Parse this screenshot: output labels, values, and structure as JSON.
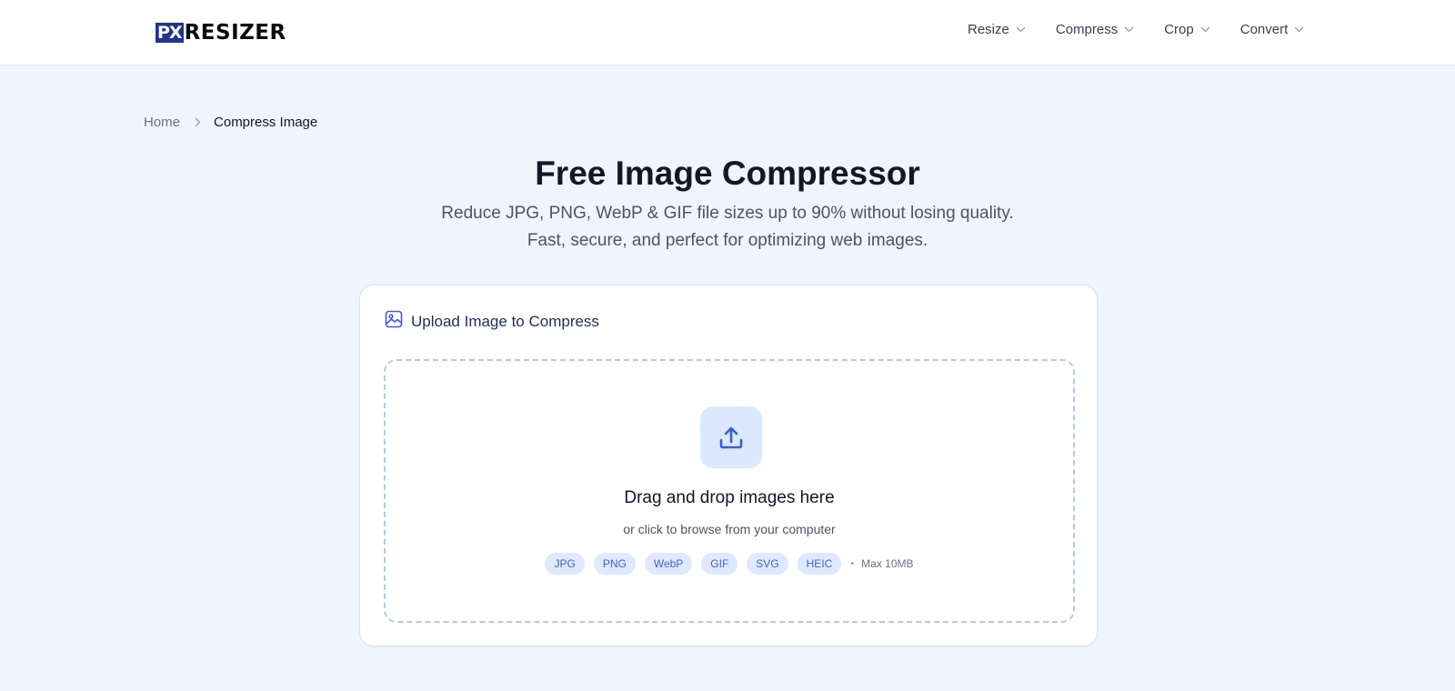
{
  "logo": {
    "prefix": "PX",
    "name": "RESIZER"
  },
  "nav": {
    "items": [
      {
        "label": "Resize"
      },
      {
        "label": "Compress"
      },
      {
        "label": "Crop"
      },
      {
        "label": "Convert"
      }
    ]
  },
  "breadcrumb": {
    "home": "Home",
    "current": "Compress Image"
  },
  "hero": {
    "title": "Free Image Compressor",
    "subtitle_line1": "Reduce JPG, PNG, WebP & GIF file sizes up to 90% without losing quality.",
    "subtitle_line2": "Fast, secure, and perfect for optimizing web images."
  },
  "upload": {
    "heading": "Upload Image to Compress",
    "drop_title": "Drag and drop images here",
    "drop_subtitle": "or click to browse from your computer",
    "formats": [
      "JPG",
      "PNG",
      "WebP",
      "GIF",
      "SVG",
      "HEIC"
    ],
    "separator": "•",
    "max_size": "Max 10MB"
  },
  "colors": {
    "page_bg": "#f0f5fd",
    "accent": "#3b5bdb",
    "logo_badge": "#24348a",
    "chip_bg": "#dfe9fc",
    "dashed_border": "#b4c8ea"
  },
  "icons": {
    "nav_chevron": "chevron-down-icon",
    "breadcrumb_sep": "chevron-right-icon",
    "card_heading": "image-icon",
    "upload": "upload-icon"
  }
}
